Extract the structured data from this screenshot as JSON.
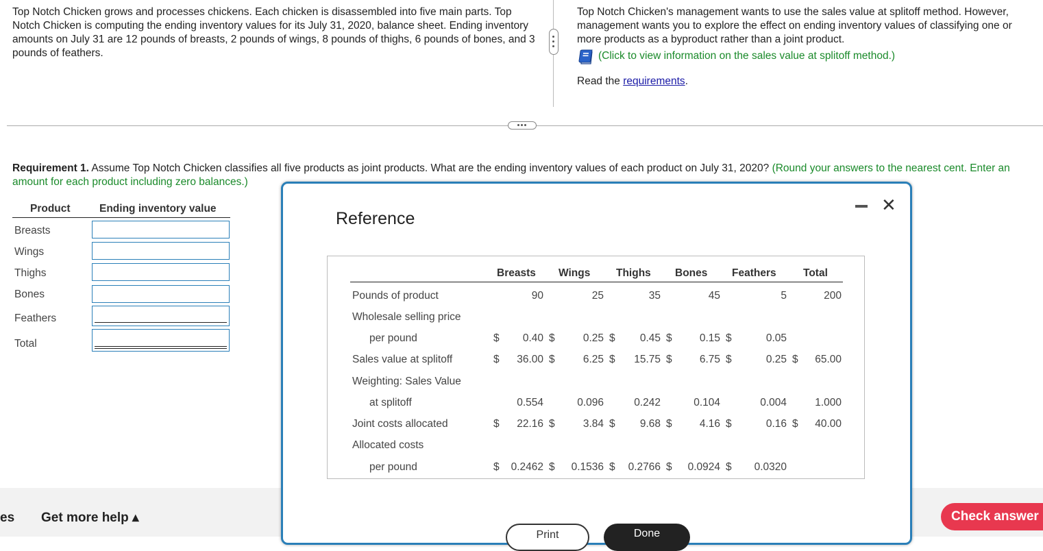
{
  "intro": {
    "left": "Top Notch Chicken grows and processes chickens. Each chicken is disassembled into five main parts. Top Notch Chicken is computing the ending inventory values for its July 31, 2020, balance sheet. Ending inventory amounts on July 31 are 12 pounds of breasts, 2 pounds of wings, 8 pounds of thighs, 6 pounds of bones, and 3 pounds of feathers.",
    "right": "Top Notch Chicken's management wants to use the sales value at splitoff method. However, management wants you to explore the effect on ending inventory values of classifying one or more products as a byproduct rather than a joint product.",
    "info_link": "(Click to view information on the sales value at splitoff method.)",
    "read_prefix": "Read the ",
    "requirements_link": "requirements",
    "read_suffix": "."
  },
  "requirement": {
    "label": "Requirement 1.",
    "text": " Assume Top Notch Chicken classifies all five products as joint products. What are the ending inventory values of each product on July 31, 2020? ",
    "hint": "(Round your answers to the nearest cent. Enter an amount for each product including zero balances.)"
  },
  "answer_table": {
    "headers": [
      "Product",
      "Ending inventory value"
    ],
    "rows": [
      "Breasts",
      "Wings",
      "Thighs",
      "Bones",
      "Feathers",
      "Total"
    ]
  },
  "reference": {
    "title": "Reference",
    "columns": [
      "Breasts",
      "Wings",
      "Thighs",
      "Bones",
      "Feathers",
      "Total"
    ],
    "pounds_label": "Pounds of product",
    "pounds": [
      "90",
      "25",
      "35",
      "45",
      "5",
      "200"
    ],
    "wsp_label_1": "Wholesale selling price",
    "wsp_label_2": "per pound",
    "wsp": [
      "0.40",
      "0.25",
      "0.45",
      "0.15",
      "0.05"
    ],
    "svs_label": "Sales value at splitoff",
    "svs": [
      "36.00",
      "6.25",
      "15.75",
      "6.75",
      "0.25",
      "65.00"
    ],
    "weight_label_1": "Weighting: Sales Value",
    "weight_label_2": "at splitoff",
    "weight": [
      "0.554",
      "0.096",
      "0.242",
      "0.104",
      "0.004",
      "1.000"
    ],
    "joint_label": "Joint costs allocated",
    "joint": [
      "22.16",
      "3.84",
      "9.68",
      "4.16",
      "0.16",
      "40.00"
    ],
    "alloc_label_1": "Allocated costs",
    "alloc_label_2": "per pound",
    "alloc": [
      "0.2462",
      "0.1536",
      "0.2766",
      "0.0924",
      "0.0320"
    ],
    "dollar": "$",
    "print_label": "Print",
    "done_label": "Done"
  },
  "bottom": {
    "left_fragment": "es",
    "help_label": "Get more help ▴",
    "check_label": "Check answer"
  },
  "colors": {
    "accent": "#2a7fb8",
    "hint_green": "#1a8a2a",
    "check_button": "#e8384f"
  }
}
